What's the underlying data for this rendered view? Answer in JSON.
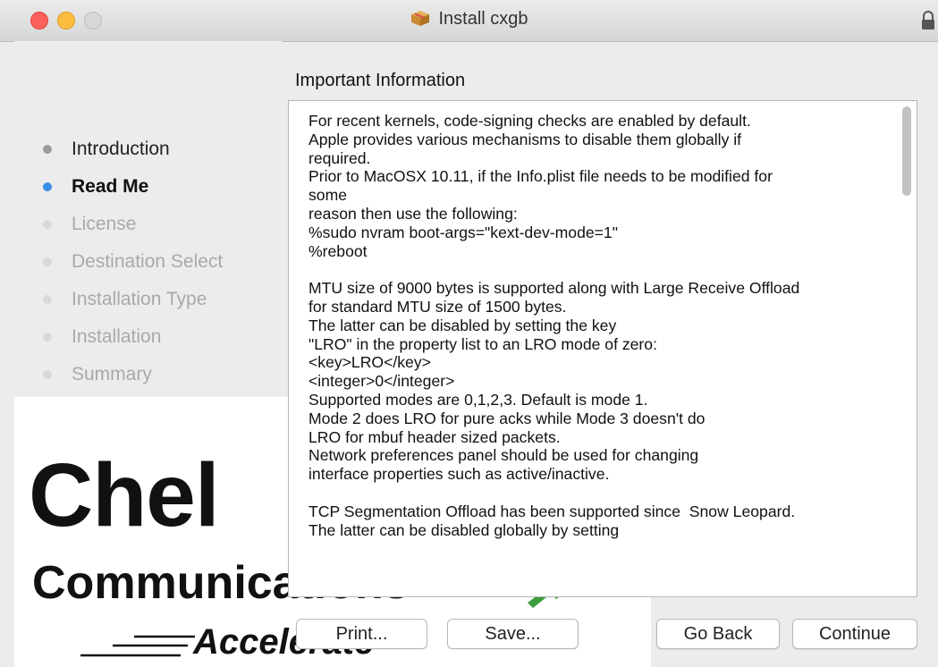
{
  "window": {
    "title": "Install cxgb"
  },
  "sidebar": {
    "steps": [
      {
        "label": "Introduction",
        "state": "done"
      },
      {
        "label": "Read Me",
        "state": "current"
      },
      {
        "label": "License",
        "state": "pending"
      },
      {
        "label": "Destination Select",
        "state": "pending"
      },
      {
        "label": "Installation Type",
        "state": "pending"
      },
      {
        "label": "Installation",
        "state": "pending"
      },
      {
        "label": "Summary",
        "state": "pending"
      }
    ]
  },
  "logo": {
    "main": "Chel",
    "sub": "Communications",
    "tagline": "Accelerate"
  },
  "main": {
    "heading": "Important Information",
    "body": "For recent kernels, code-signing checks are enabled by default.\nApple provides various mechanisms to disable them globally if\nrequired.\nPrior to MacOSX 10.11, if the Info.plist file needs to be modified for\nsome\nreason then use the following:\n%sudo nvram boot-args=\"kext-dev-mode=1\"\n%reboot\n\nMTU size of 9000 bytes is supported along with Large Receive Offload\nfor standard MTU size of 1500 bytes.\nThe latter can be disabled by setting the key\n\"LRO\" in the property list to an LRO mode of zero:\n<key>LRO</key>\n<integer>0</integer>\nSupported modes are 0,1,2,3. Default is mode 1.\nMode 2 does LRO for pure acks while Mode 3 doesn't do\nLRO for mbuf header sized packets.\nNetwork preferences panel should be used for changing\ninterface properties such as active/inactive.\n\nTCP Segmentation Offload has been supported since  Snow Leopard.\nThe latter can be disabled globally by setting"
  },
  "buttons": {
    "print": "Print...",
    "save": "Save...",
    "back": "Go Back",
    "continue": "Continue"
  },
  "icons": {
    "package": "package-icon",
    "lock": "lock-icon"
  },
  "colors": {
    "close": "#fc605c",
    "minimize": "#fdbc40",
    "current_step": "#3a8ee6"
  }
}
